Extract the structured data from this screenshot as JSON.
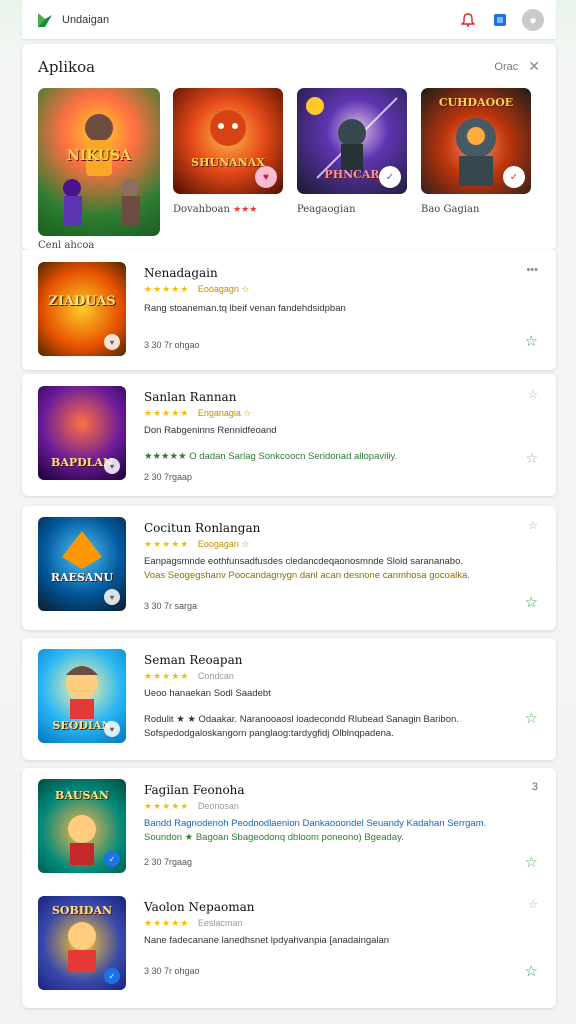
{
  "header": {
    "app_title": "Undaigan"
  },
  "featured_section": {
    "title": "Aplikoa",
    "action_label": "Orac",
    "items": [
      {
        "art_text": "NIKUSA",
        "label": "Cenl ahcoa",
        "badge": ""
      },
      {
        "art_text": "SHUNANAX",
        "label": "Dovahboan",
        "stars": "★★★",
        "badge": "♥"
      },
      {
        "art_text": "PHNCAR",
        "label": "Peagaogian",
        "badge": "✓"
      },
      {
        "art_text": "CUHDAOOE",
        "label": "Bao Gagian",
        "badge": "✓"
      }
    ]
  },
  "list": [
    {
      "title": "Nenadagain",
      "stars": "★★★★★",
      "rating_text": "Eooagagn ☆",
      "desc1": "Rang stoaneman.tq lbeif venan fandehdsidpban",
      "desc2": "",
      "meta": "3 30 7r ohgao",
      "art_text": "ZIADUAS",
      "menu": "•••",
      "fav": "☆"
    },
    {
      "title": "Sanlan Rannan",
      "stars": "★★★★★",
      "rating_text": "Enganagia ☆",
      "desc1": "Don Rabgeninns  Rennidfeoand",
      "desc2": "★★★★★  O dadan Sarlag  Sonkcoocn  Seridonad allopaviliy.",
      "meta": "2 30 7rgaap",
      "art_text": "BAPDLAN",
      "menu": "☆",
      "fav": "☆"
    },
    {
      "title": "Cocitun Ronlangan",
      "stars": "★★★★★",
      "rating_text": "Eoogagan ☆",
      "desc1": "Eanpagsmnde eothfunsadfusdes cledancdeqaonosmnde Sloid sarananabo.",
      "desc2": "Voas Seogegshanv Poocandagnygn danl acan desnone canmhosa gocoalka.",
      "meta": "3 30 7r sarga",
      "art_text": "RAESANU",
      "menu": "☆",
      "fav": "☆"
    },
    {
      "title": "Seman Reoapan",
      "stars": "★★★★★",
      "rating_text": "Condcan",
      "desc1": "Ueoo hanaekan Sodl  Saadebt",
      "desc2": "Rodulit ★ ★ Odaakar.  Naranooaosl loadecondd Rlubead  Sanagin  Baribon.",
      "desc3": "Sofspedodgaloskangorn panglaog:tardygfidj  Olblnqpadena.",
      "meta": "",
      "art_text": "SEODIAN",
      "menu": "",
      "fav": "☆"
    },
    {
      "title": "Fagilan Feonoha",
      "stars": "★★★★★",
      "rating_text": "Deonosan",
      "desc1": "Bandd  Ragnodenoh   Peodnodlaenion Dankaooondel Seuandy Kadahan Serrgam.",
      "desc2": "Soundon ★ Bagoan Sbageodonq dbloom poneono) Bgeaday.",
      "meta": "2 30 7rgaag",
      "art_text": "BAUSAN",
      "menu": "3",
      "fav": "☆"
    },
    {
      "title": "Vaolon Nepaoman",
      "stars": "★★★★★",
      "rating_text": "Eeslacman",
      "desc1": "Nane fadecanane lanedhsnet lpdyahvanpia  [anadaingalan",
      "desc2": "",
      "meta": "3 30 7r ohgao",
      "art_text": "SOBIDAN",
      "menu": "☆",
      "fav": "☆"
    }
  ],
  "colors": {
    "accent": "#34a853",
    "star": "#fbbc04",
    "brand": "#1e8e3e"
  }
}
